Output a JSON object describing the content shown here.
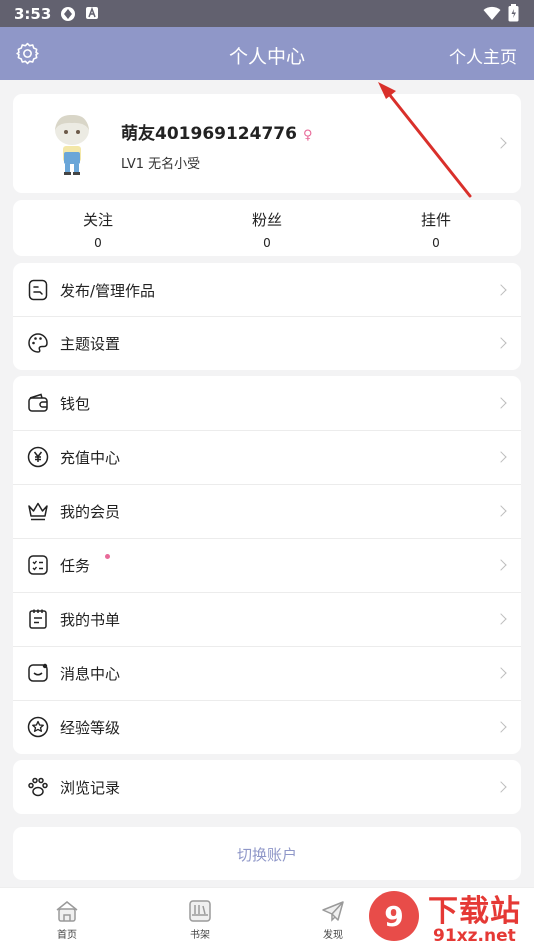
{
  "status_bar": {
    "time": "3:53"
  },
  "header": {
    "title": "个人中心",
    "right_link": "个人主页",
    "left_icon": "gear-icon"
  },
  "profile": {
    "username": "萌友401969124776",
    "gender_symbol": "♀",
    "level": "LV1 无名小受"
  },
  "stats": [
    {
      "label": "关注",
      "value": "0"
    },
    {
      "label": "粉丝",
      "value": "0"
    },
    {
      "label": "挂件",
      "value": "0"
    }
  ],
  "menu_group1": [
    {
      "label": "发布/管理作品",
      "icon": "publish-icon"
    },
    {
      "label": "主题设置",
      "icon": "palette-icon"
    }
  ],
  "menu_group2": [
    {
      "label": "钱包",
      "icon": "wallet-icon"
    },
    {
      "label": "充值中心",
      "icon": "yuan-coin-icon"
    },
    {
      "label": "我的会员",
      "icon": "crown-icon"
    },
    {
      "label": "任务",
      "icon": "task-list-icon",
      "badge": "red-dot"
    },
    {
      "label": "我的书单",
      "icon": "notebook-icon"
    },
    {
      "label": "消息中心",
      "icon": "message-icon"
    },
    {
      "label": "经验等级",
      "icon": "star-badge-icon"
    }
  ],
  "menu_group3": [
    {
      "label": "浏览记录",
      "icon": "paw-icon"
    }
  ],
  "switch_account": "切换账户",
  "tabbar": [
    {
      "label": "首页",
      "icon": "home-icon"
    },
    {
      "label": "书架",
      "icon": "bookshelf-icon"
    },
    {
      "label": "发现",
      "icon": "paper-plane-icon"
    }
  ],
  "watermark": {
    "brand": "下载站",
    "domain": "91xz.net"
  },
  "colors": {
    "header_bg": "#8f97c8",
    "status_bg": "#62616f",
    "accent_pink": "#e86a99",
    "page_bg": "#f3f3f4",
    "arrow": "#d9302b"
  }
}
